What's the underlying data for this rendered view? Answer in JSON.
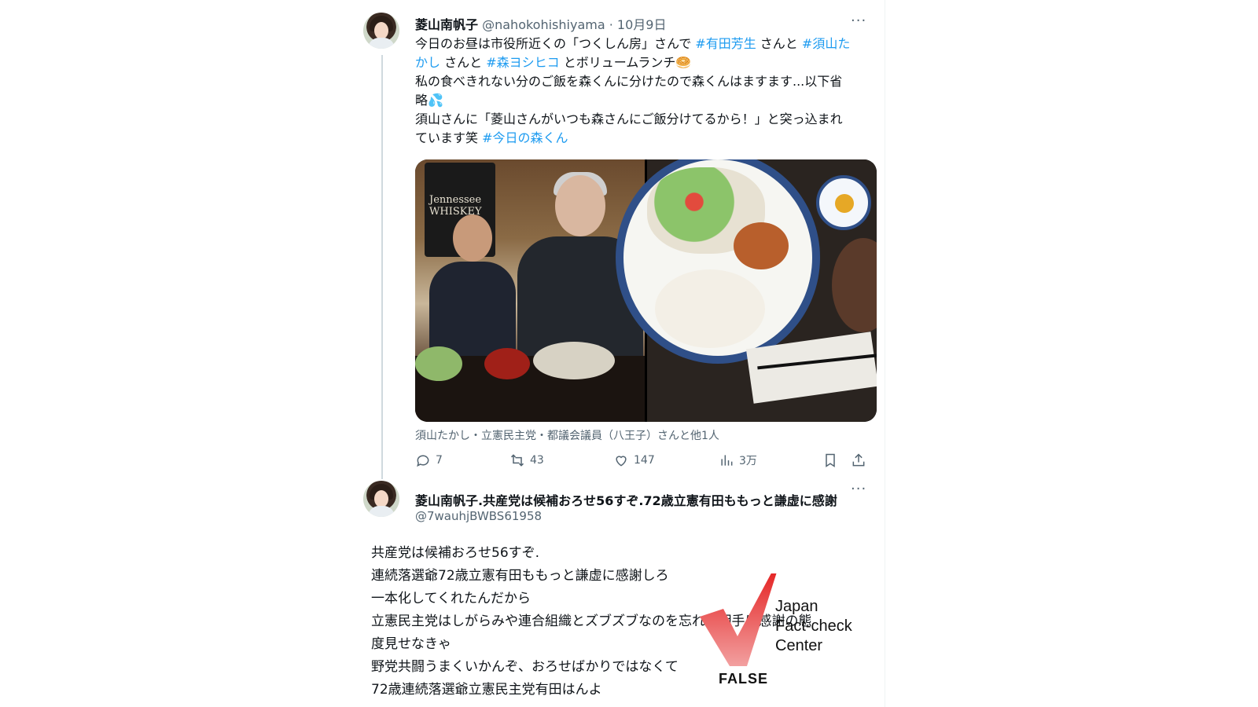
{
  "tweet1": {
    "display_name": "菱山南帆子",
    "handle": "@nahokohishiyama",
    "sep": "·",
    "date": "10月9日",
    "more": "···",
    "text_lines": [
      {
        "parts": [
          {
            "t": "今日のお昼は市役所近くの「つくしん房」さんで ",
            "tag": false
          },
          {
            "t": "#有田芳生",
            "tag": true
          },
          {
            "t": " さんと ",
            "tag": false
          },
          {
            "t": "#須山た",
            "tag": true
          }
        ]
      },
      {
        "parts": [
          {
            "t": "かし",
            "tag": true
          },
          {
            "t": " さんと ",
            "tag": false
          },
          {
            "t": "#森ヨシヒコ",
            "tag": true
          },
          {
            "t": " とボリュームランチ🥯",
            "tag": false
          }
        ]
      },
      {
        "parts": [
          {
            "t": "私の食べきれない分のご飯を森くんに分けたので森くんはますます...以下省",
            "tag": false
          }
        ]
      },
      {
        "parts": [
          {
            "t": "略💦",
            "tag": false
          }
        ]
      },
      {
        "parts": [
          {
            "t": "須山さんに「菱山さんがいつも森さんにご飯分けてるから！」と突っ込まれ",
            "tag": false
          }
        ]
      },
      {
        "parts": [
          {
            "t": "ています笑 ",
            "tag": false
          },
          {
            "t": "#今日の森くん",
            "tag": true
          }
        ]
      }
    ],
    "photo1_poster_text": "Jennessee WHISKEY",
    "media_caption": "須山たかし・立憲民主党・都議会議員（八王子）さんと他1人",
    "actions": {
      "reply_count": "7",
      "retweet_count": "43",
      "like_count": "147",
      "view_count": "3万"
    }
  },
  "tweet2": {
    "display_name": "菱山南帆子.共産党は候補おろせ56すぞ.72歳立憲有田ももっと謙虚に感謝",
    "handle": "@7wauhjBWBS61958",
    "more": "···",
    "lines": [
      "共産党は候補おろせ56すぞ.",
      "連続落選爺72歳立憲有田ももっと謙虚に感謝しろ",
      "一本化してくれたんだから",
      "立憲民主党はしがらみや連合組織とズブズブなのを忘れて相手に感謝の態",
      "度見せなきゃ",
      "野党共闘うまくいかんぞ、おろせばかりではなくて",
      "72歳連続落選爺立憲民主党有田はんよ"
    ]
  },
  "stamp": {
    "verdict": "FALSE",
    "org_lines": [
      "Japan",
      "Fact-check",
      "Center"
    ],
    "check_color": "#e41f1f"
  },
  "colors": {
    "link": "#1d9bf0",
    "secondary_text": "#536471",
    "primary_text": "#0f1419"
  }
}
